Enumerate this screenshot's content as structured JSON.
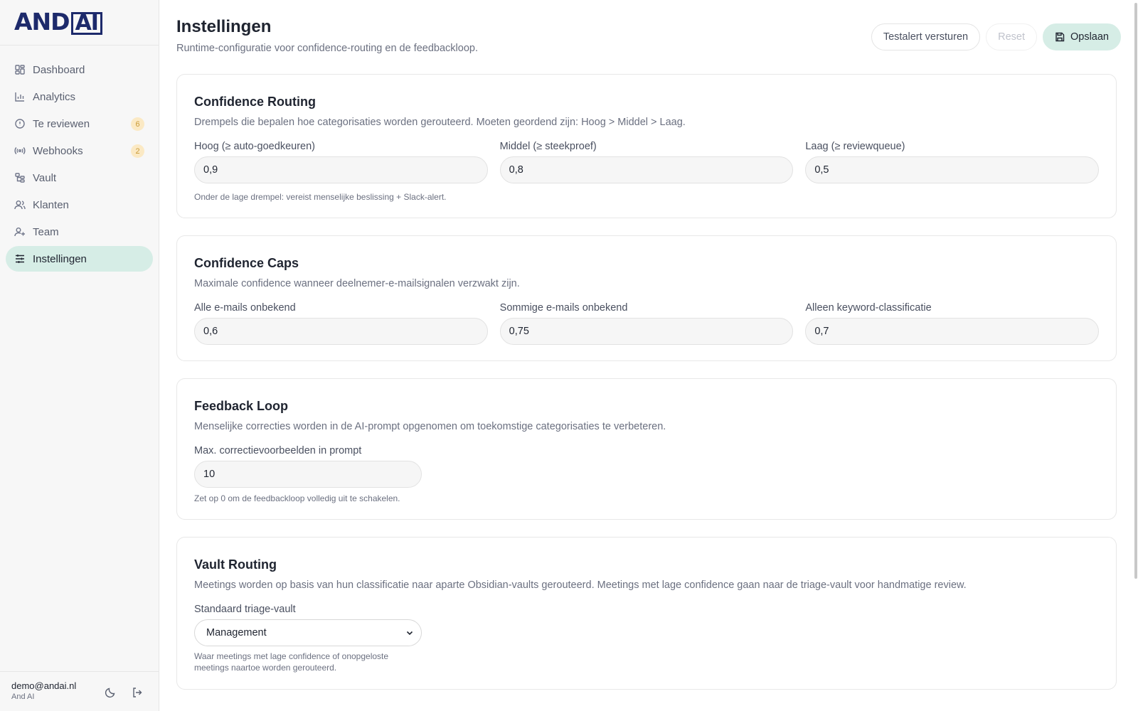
{
  "app": {
    "logo": "AND",
    "logo_box": "AI"
  },
  "sidebar": {
    "items": [
      {
        "label": "Dashboard",
        "icon": "dashboard-grid-icon"
      },
      {
        "label": "Analytics",
        "icon": "bar-chart-icon"
      },
      {
        "label": "Te reviewen",
        "icon": "alert-circle-icon",
        "badge": "6"
      },
      {
        "label": "Webhooks",
        "icon": "radio-signal-icon",
        "badge": "2"
      },
      {
        "label": "Vault",
        "icon": "folder-tree-icon"
      },
      {
        "label": "Klanten",
        "icon": "users-icon"
      },
      {
        "label": "Team",
        "icon": "user-plus-icon"
      },
      {
        "label": "Instellingen",
        "icon": "sliders-icon",
        "active": true
      }
    ]
  },
  "user": {
    "email": "demo@andai.nl",
    "org": "And AI"
  },
  "header": {
    "title": "Instellingen",
    "subtitle": "Runtime-configuratie voor confidence-routing en de feedbackloop.",
    "btn_test": "Testalert versturen",
    "btn_reset": "Reset",
    "btn_save": "Opslaan"
  },
  "routing": {
    "title": "Confidence Routing",
    "desc": "Drempels die bepalen hoe categorisaties worden gerouteerd. Moeten geordend zijn: Hoog > Middel > Laag.",
    "high_label": "Hoog (≥ auto-goedkeuren)",
    "high_value": "0,9",
    "mid_label": "Middel (≥ steekproef)",
    "mid_value": "0,8",
    "low_label": "Laag (≥ reviewqueue)",
    "low_value": "0,5",
    "hint": "Onder de lage drempel: vereist menselijke beslissing + Slack-alert."
  },
  "caps": {
    "title": "Confidence Caps",
    "desc": "Maximale confidence wanneer deelnemer-e-mailsignalen verzwakt zijn.",
    "all_label": "Alle e-mails onbekend",
    "all_value": "0,6",
    "some_label": "Sommige e-mails onbekend",
    "some_value": "0,75",
    "kw_label": "Alleen keyword-classificatie",
    "kw_value": "0,7"
  },
  "feedback": {
    "title": "Feedback Loop",
    "desc": "Menselijke correcties worden in de AI-prompt opgenomen om toekomstige categorisaties te verbeteren.",
    "max_label": "Max. correctievoorbeelden in prompt",
    "max_value": "10",
    "hint": "Zet op 0 om de feedbackloop volledig uit te schakelen."
  },
  "vault": {
    "title": "Vault Routing",
    "desc": "Meetings worden op basis van hun classificatie naar aparte Obsidian-vaults gerouteerd. Meetings met lage confidence gaan naar de triage-vault voor handmatige review.",
    "triage_label": "Standaard triage-vault",
    "triage_value": "Management",
    "hint": "Waar meetings met lage confidence of onopgeloste meetings naartoe worden gerouteerd."
  }
}
